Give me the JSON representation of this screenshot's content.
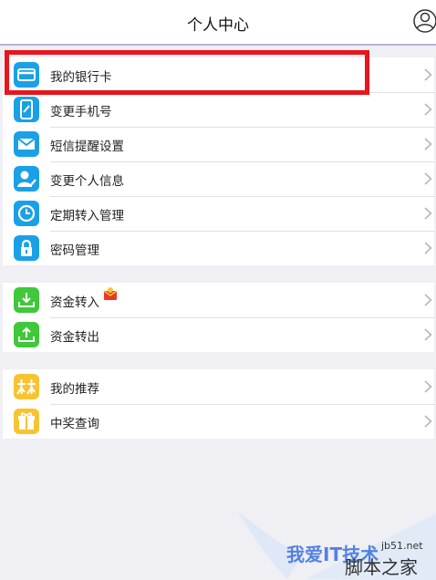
{
  "header": {
    "title": "个人中心"
  },
  "groups": [
    {
      "items": [
        {
          "label": "我的银行卡",
          "icon": "bank-card-icon",
          "color": "#1aa0e6"
        },
        {
          "label": "变更手机号",
          "icon": "phone-edit-icon",
          "color": "#1aa0e6"
        },
        {
          "label": "短信提醒设置",
          "icon": "mail-icon",
          "color": "#1aa0e6"
        },
        {
          "label": "变更个人信息",
          "icon": "user-edit-icon",
          "color": "#1aa0e6"
        },
        {
          "label": "定期转入管理",
          "icon": "clock-icon",
          "color": "#1aa0e6"
        },
        {
          "label": "密码管理",
          "icon": "lock-icon",
          "color": "#1aa0e6"
        }
      ]
    },
    {
      "items": [
        {
          "label": "资金转入",
          "icon": "download-icon",
          "color": "#3ec83a",
          "badge": "gift-badge-icon"
        },
        {
          "label": "资金转出",
          "icon": "upload-icon",
          "color": "#3ec83a"
        }
      ]
    },
    {
      "items": [
        {
          "label": "我的推荐",
          "icon": "recommend-icon",
          "color": "#f7c331"
        },
        {
          "label": "中奖查询",
          "icon": "gift-icon",
          "color": "#f7c331"
        }
      ]
    }
  ],
  "watermark": {
    "brand": "我爱IT技术",
    "site": "jb51.net",
    "text": "脚本之家"
  },
  "colors": {
    "highlight": "#e8141e",
    "blue": "#1aa0e6",
    "green": "#3ec83a",
    "yellow": "#f7c331"
  }
}
